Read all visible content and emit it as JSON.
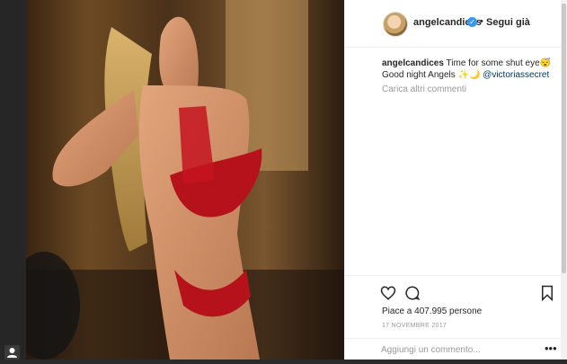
{
  "colors": {
    "accent": "#3897f0",
    "mention": "#003569",
    "muted": "#999999",
    "text": "#262626"
  },
  "post": {
    "username": "angelcandices",
    "separator": "•",
    "follow_label": "Segui già",
    "verified_icon": "verified-badge-icon",
    "caption_text": "Time for some shut eye😴 Good night Angels ✨🌙 ",
    "mention": "@victoriassecret",
    "load_more": "Carica altri commenti",
    "likes": "Piace a 407.995 persone",
    "date": "17 NOVEMBRE 2017",
    "comment_placeholder": "Aggiungi un commento...",
    "more_label": "•••"
  },
  "icons": {
    "like": "heart-icon",
    "comment": "comment-bubble-icon",
    "save": "bookmark-icon",
    "corner": "user-icon"
  }
}
